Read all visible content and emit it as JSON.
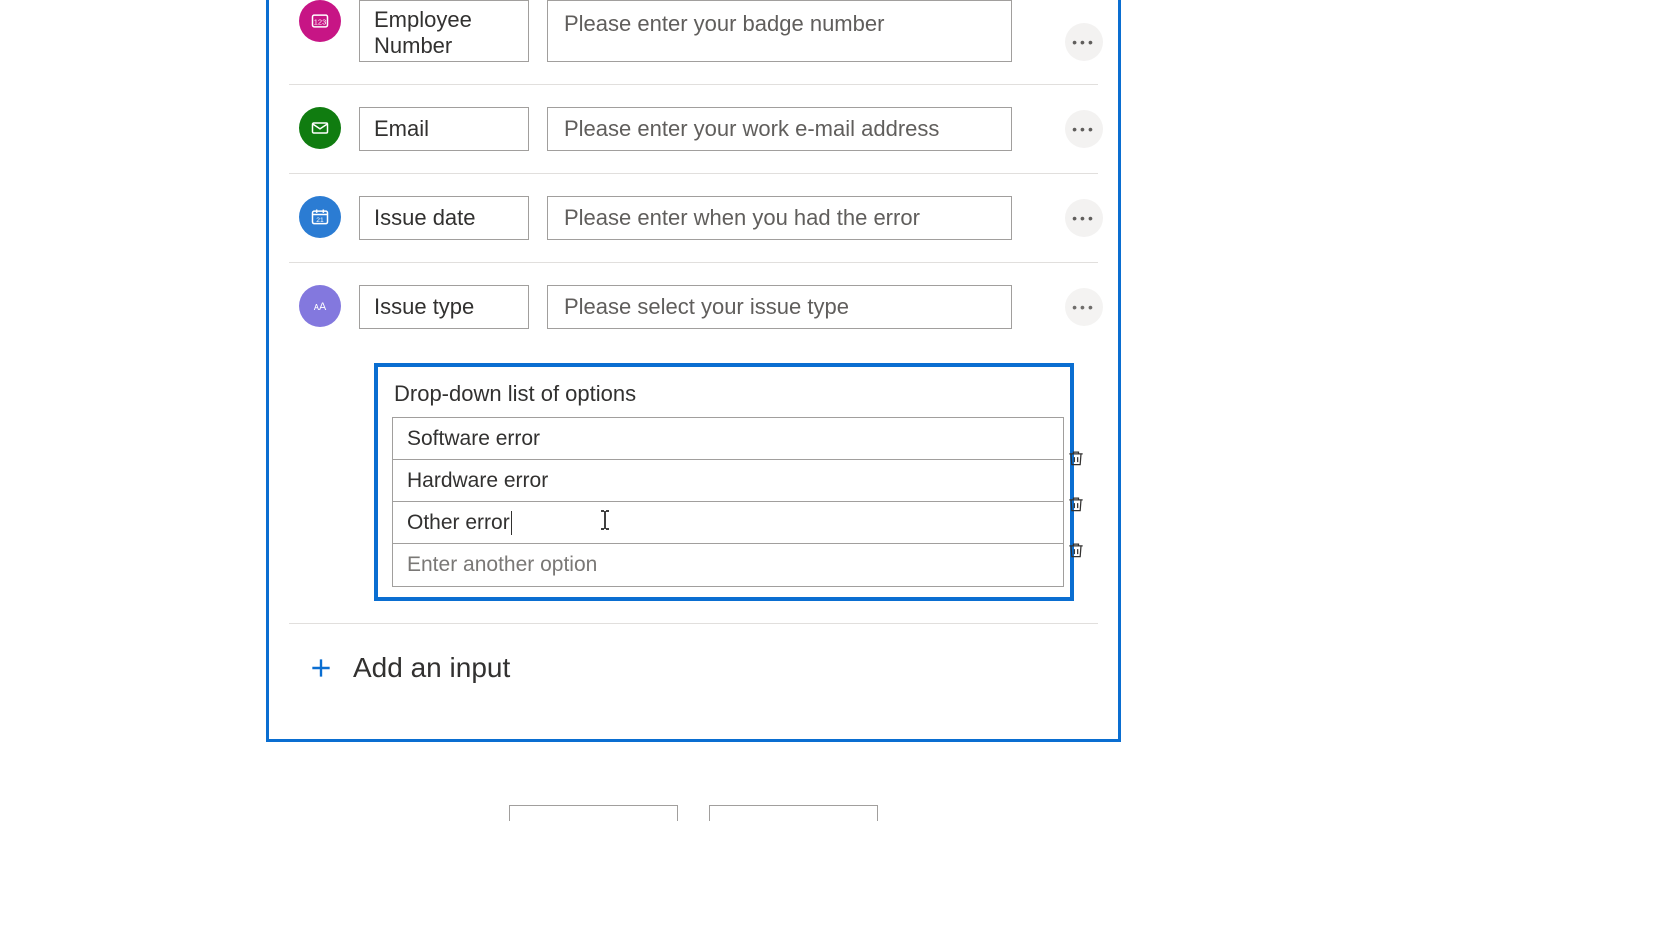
{
  "inputs": [
    {
      "icon": "number-icon",
      "icon_color": "pink",
      "name": "Employee Number",
      "prompt": "Please enter your badge number",
      "multiline": true
    },
    {
      "icon": "email-icon",
      "icon_color": "green",
      "name": "Email",
      "prompt": "Please enter your work e-mail address",
      "multiline": false
    },
    {
      "icon": "date-icon",
      "icon_color": "blue",
      "name": "Issue date",
      "prompt": "Please enter when you had the error",
      "multiline": false
    },
    {
      "icon": "text-icon",
      "icon_color": "purple",
      "name": "Issue type",
      "prompt": "Please select your issue type",
      "multiline": false
    }
  ],
  "dropdown": {
    "title": "Drop-down list of options",
    "options": [
      "Software error",
      "Hardware error",
      "Other error"
    ],
    "new_option_placeholder": "Enter another option"
  },
  "add_input_label": "Add an input"
}
